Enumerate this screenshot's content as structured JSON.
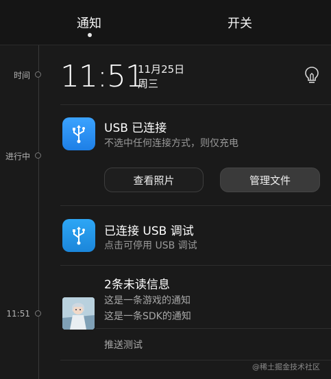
{
  "tabs": {
    "notifications_label": "通知",
    "toggles_label": "开关"
  },
  "timeline": {
    "label_time": "时间",
    "label_ongoing": "进行中",
    "label_1151": "11:51"
  },
  "header": {
    "time": "11:51",
    "date": "11月25日",
    "weekday": "周三"
  },
  "usb_connected": {
    "title": "USB 已连接",
    "subtitle": "不选中任何连接方式，则仅充电",
    "button_photos": "查看照片",
    "button_files": "管理文件"
  },
  "usb_debug": {
    "title": "已连接 USB 调试",
    "subtitle": "点击可停用 USB 调试"
  },
  "unread": {
    "title": "2条未读信息",
    "line1": "这是一条游戏的通知",
    "line2": "这是一条SDK的通知",
    "footer": "推送测试"
  },
  "watermark": "@稀土掘金技术社区",
  "icons": {
    "usb": "usb-icon",
    "bulb": "lightbulb-icon"
  },
  "colors": {
    "background": "#1a1a1a",
    "accent_blue": "#2a8ef0"
  }
}
